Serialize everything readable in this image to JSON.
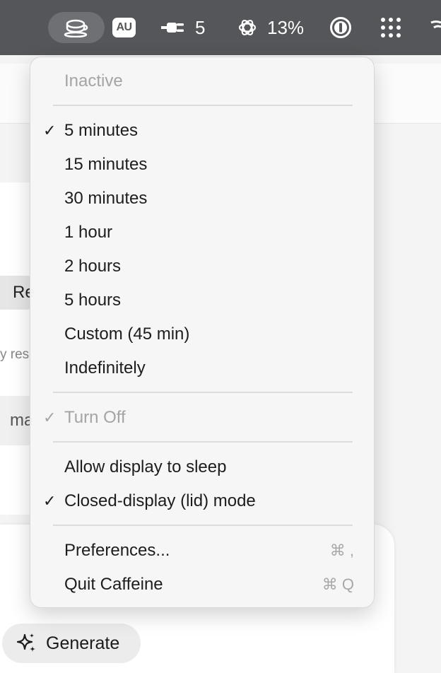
{
  "menubar": {
    "au_badge": "AU",
    "power_count": "5",
    "openai_percent": "13%",
    "icons": [
      "caffeine-cup-icon",
      "au-badge-icon",
      "power-plug-icon",
      "openai-icon",
      "1password-icon",
      "grid-icon",
      "wifi-icon"
    ]
  },
  "menu": {
    "header": "Inactive",
    "durations": [
      {
        "label": "5 minutes",
        "checked": "✓"
      },
      {
        "label": "15 minutes",
        "checked": ""
      },
      {
        "label": "30 minutes",
        "checked": ""
      },
      {
        "label": "1 hour",
        "checked": ""
      },
      {
        "label": "2 hours",
        "checked": ""
      },
      {
        "label": "5 hours",
        "checked": ""
      },
      {
        "label": "Custom (45 min)",
        "checked": ""
      },
      {
        "label": "Indefinitely",
        "checked": ""
      }
    ],
    "turn_off": {
      "label": "Turn Off",
      "checked": "✓"
    },
    "allow_display_sleep": {
      "label": "Allow display to sleep",
      "checked": ""
    },
    "closed_display_mode": {
      "label": "Closed-display (lid) mode",
      "checked": "✓"
    },
    "preferences": {
      "label": "Preferences...",
      "shortcut": "⌘ ,"
    },
    "quit": {
      "label": "Quit Caffeine",
      "shortcut": "⌘ Q"
    }
  },
  "background": {
    "chip_text": "Re",
    "faded_text": "y res",
    "field_text": "ma",
    "generate_label": "Generate"
  },
  "colors": {
    "menubar_bg": "#555659",
    "menu_bg": "#f6f6f7",
    "disabled_text": "#a4a4a6"
  }
}
